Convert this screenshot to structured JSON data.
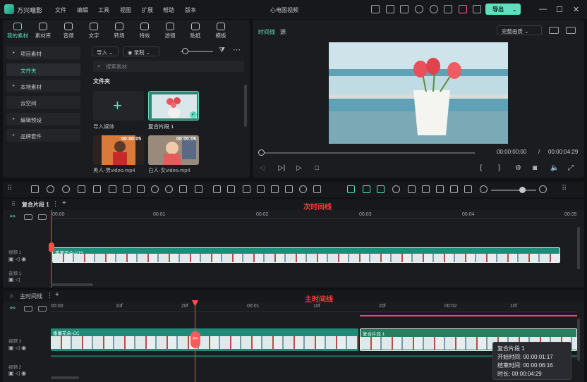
{
  "app": {
    "name": "万兴喵影",
    "window_title": "心电图视频",
    "export_label": "导出"
  },
  "menu": [
    "文件",
    "编辑",
    "工具",
    "视图",
    "扩展",
    "帮助",
    "版本"
  ],
  "media_tabs": [
    "我的素材",
    "素材库",
    "音频",
    "文字",
    "转场",
    "特效",
    "滤镜",
    "贴纸",
    "模板"
  ],
  "tree": [
    "项目素材",
    "文件夹",
    "本地素材",
    "云空间",
    "编辑预设",
    "品牌套件"
  ],
  "media_toolbar": {
    "import": "导入",
    "record": "录制"
  },
  "search": {
    "placeholder": "搜索素材"
  },
  "folder_label": "文件夹",
  "media_items": [
    {
      "name": "导入媒体",
      "duration": ""
    },
    {
      "name": "复合片段 1",
      "duration": ""
    },
    {
      "name": "黑人-男video.mp4",
      "duration": "00:00:05"
    },
    {
      "name": "白人-女video.mp4",
      "duration": "00:00:06"
    }
  ],
  "preview": {
    "tab_timeline": "时间线",
    "tab_source": "源",
    "quality": "完整画质",
    "current_time": "00:00:00:00",
    "separator": "/",
    "total_time": "00:00:04:29"
  },
  "timeline1": {
    "name": "复合片段 1",
    "annotation": "次时间线",
    "ruler": [
      "00:00",
      "00:01",
      "00:02",
      "00:03",
      "00:04",
      "00:05"
    ],
    "tracks": [
      "视频 1",
      "音频 1"
    ],
    "clip_label": "番薯花朵-V15"
  },
  "timeline2": {
    "name": "主时间线",
    "annotation": "主时间线",
    "ruler": [
      "00:00",
      "10f",
      "20f",
      "00:01",
      "10f",
      "20f",
      "00:02",
      "10f"
    ],
    "tracks": [
      "视频 3",
      "视频 2"
    ],
    "clip1_label": "番薯花朵-CC",
    "clip2_label": "复合片段 1"
  },
  "tooltip": {
    "title": "复合片段 1",
    "start_label": "开始时间:",
    "start": "00:00:01:17",
    "end_label": "结束时间:",
    "end": "00:00:06:16",
    "duration_label": "时长:",
    "duration": "00:00:04:29"
  },
  "colors": {
    "accent": "#5ce0bd",
    "clip": "#1e8a78",
    "playhead": "#ff4d4d",
    "annotation": "#ff3b3b"
  }
}
